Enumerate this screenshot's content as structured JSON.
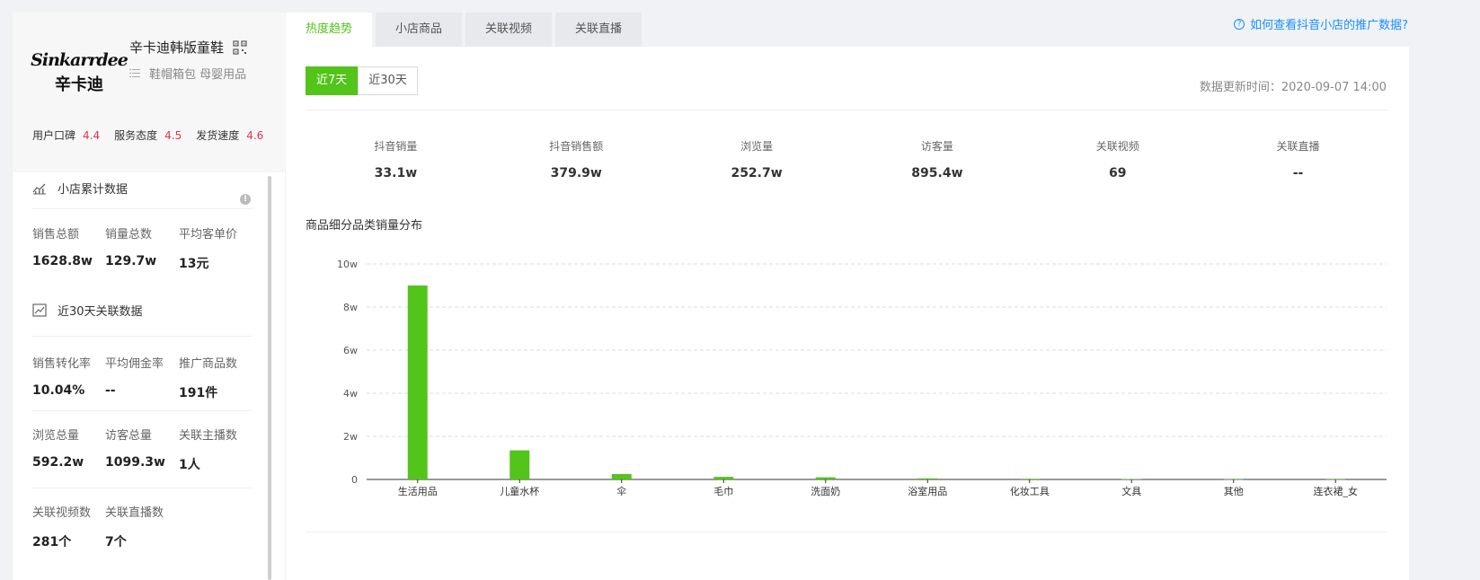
{
  "shop": {
    "logo_text_en": "Sinkarrdee",
    "logo_text_cn": "辛卡迪",
    "name": "辛卡迪韩版童鞋",
    "categories": "鞋帽箱包 母婴用品",
    "ratings": [
      {
        "label": "用户口碑",
        "value": "4.4"
      },
      {
        "label": "服务态度",
        "value": "4.5"
      },
      {
        "label": "发货速度",
        "value": "4.6"
      }
    ]
  },
  "cumulative": {
    "title": "小店累计数据",
    "metrics": [
      {
        "label": "销售总额",
        "value": "1628.8w"
      },
      {
        "label": "销量总数",
        "value": "129.7w"
      },
      {
        "label": "平均客单价",
        "value": "13元"
      }
    ]
  },
  "recent30": {
    "title": "近30天关联数据",
    "row1": [
      {
        "label": "销售转化率",
        "value": "10.04%"
      },
      {
        "label": "平均佣金率",
        "value": "--"
      },
      {
        "label": "推广商品数",
        "value": "191件"
      }
    ],
    "row2": [
      {
        "label": "浏览总量",
        "value": "592.2w"
      },
      {
        "label": "访客总量",
        "value": "1099.3w"
      },
      {
        "label": "关联主播数",
        "value": "1人"
      }
    ],
    "row3": [
      {
        "label": "关联视频数",
        "value": "281个"
      },
      {
        "label": "关联直播数",
        "value": "7个"
      }
    ]
  },
  "tabs": [
    "热度趋势",
    "小店商品",
    "关联视频",
    "关联直播"
  ],
  "help_link": "如何查看抖音小店的推广数据?",
  "range_buttons": [
    "近7天",
    "近30天"
  ],
  "update_time": "数据更新时间：2020-09-07 14:00",
  "stats": [
    {
      "label": "抖音销量",
      "value": "33.1w"
    },
    {
      "label": "抖音销售额",
      "value": "379.9w"
    },
    {
      "label": "浏览量",
      "value": "252.7w"
    },
    {
      "label": "访客量",
      "value": "895.4w"
    },
    {
      "label": "关联视频",
      "value": "69"
    },
    {
      "label": "关联直播",
      "value": "--"
    }
  ],
  "chart_title": "商品细分品类销量分布",
  "colors": {
    "accent": "#52c41a",
    "rating": "#e8314c",
    "link": "#1890ff"
  },
  "chart_data": {
    "type": "bar",
    "title": "商品细分品类销量分布",
    "categories": [
      "生活用品",
      "儿童水杯",
      "伞",
      "毛巾",
      "洗面奶",
      "浴室用品",
      "化妆工具",
      "文具",
      "其他",
      "连衣裙_女"
    ],
    "values": [
      9.0,
      1.35,
      0.25,
      0.12,
      0.1,
      0.05,
      0.03,
      0.02,
      0.01,
      0.01
    ],
    "y_ticks": [
      "0",
      "2w",
      "4w",
      "6w",
      "8w",
      "10w"
    ],
    "ylim": [
      0,
      10
    ],
    "unit": "w",
    "grid": true
  }
}
